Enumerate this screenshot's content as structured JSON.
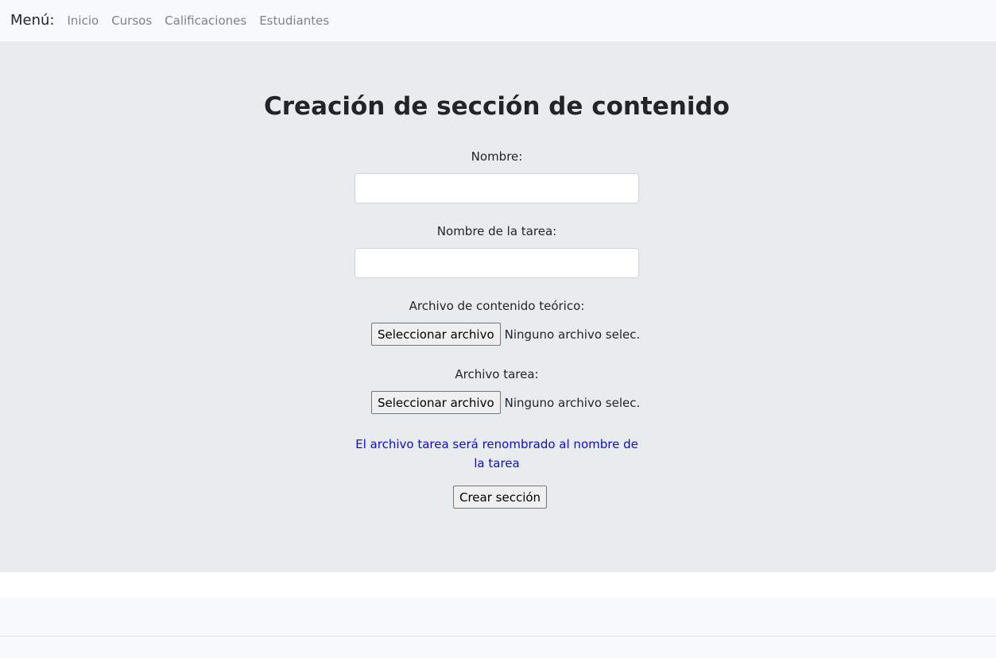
{
  "nav": {
    "brand": "Menú:",
    "links": [
      "Inicio",
      "Cursos",
      "Calificaciones",
      "Estudiantes"
    ]
  },
  "form": {
    "title": "Creación de sección de contenido",
    "nombre_label": "Nombre:",
    "nombre_value": "",
    "tarea_label": "Nombre de la tarea:",
    "tarea_value": "",
    "archivo_teorico_label": "Archivo de contenido teórico:",
    "archivo_tarea_label": "Archivo tarea:",
    "file_button_label": "Seleccionar archivo",
    "file_status": "Ninguno archivo selec.",
    "note": "El archivo tarea será renombrado al nombre de la tarea",
    "submit_label": "Crear sección"
  },
  "colors": {
    "navbar_bg": "#f8f9fa",
    "jumbotron_bg": "#e9ecef",
    "note_text": "#0d0dd6"
  }
}
